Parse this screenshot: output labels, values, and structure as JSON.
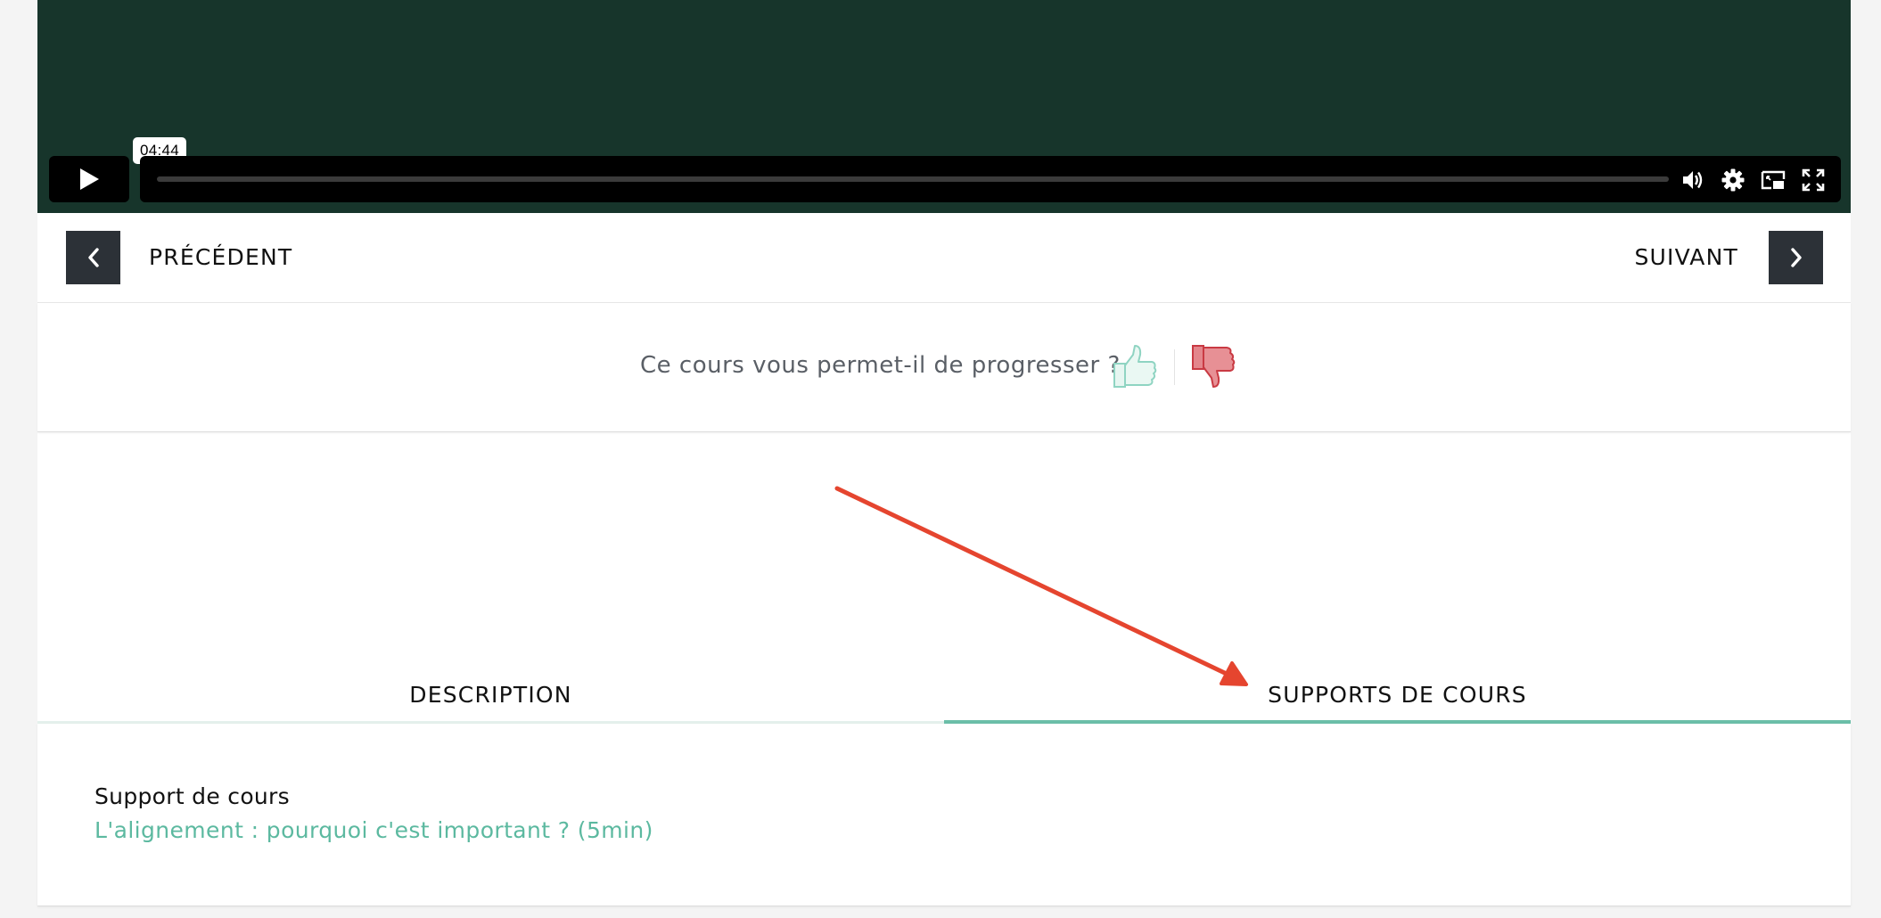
{
  "video": {
    "time_tooltip": "04:44",
    "progress": 0,
    "controls": [
      "play-icon",
      "volume-icon",
      "gear-icon",
      "pip-icon",
      "fullscreen-icon"
    ]
  },
  "nav": {
    "prev_label": "PRÉCÉDENT",
    "next_label": "SUIVANT"
  },
  "feedback": {
    "question": "Ce cours vous permet-il de progresser ?",
    "thumb_up_color": "#8fd4c2",
    "thumb_down_color": "#d9474f"
  },
  "tabs": [
    {
      "label": "DESCRIPTION",
      "active": false
    },
    {
      "label": "SUPPORTS DE COURS",
      "active": true
    }
  ],
  "content": {
    "title": "Support de cours",
    "link_text": "L'alignement : pourquoi c'est important ? (5min)"
  },
  "colors": {
    "video_bg": "#17352b",
    "accent": "#6bbfa8",
    "annotation_arrow": "#e5452f",
    "nav_button": "#2c3137"
  }
}
